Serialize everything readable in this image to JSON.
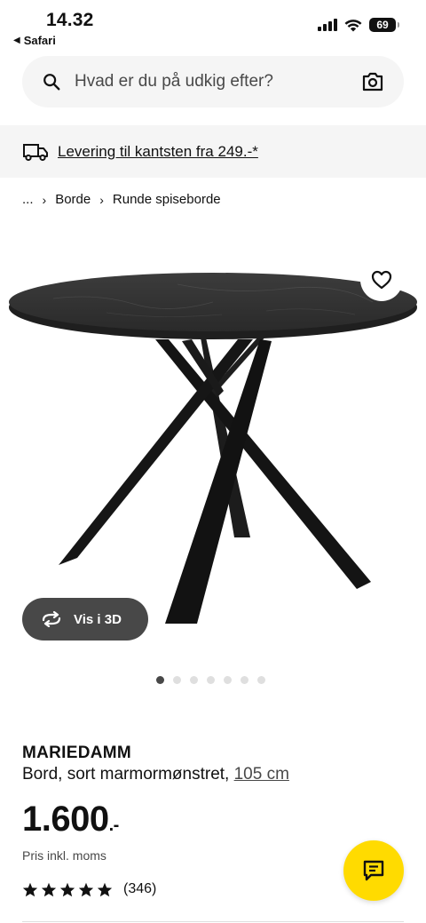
{
  "status_bar": {
    "time": "14.32",
    "back_app": "Safari",
    "battery": "69"
  },
  "search": {
    "placeholder": "Hvad er du på udkig efter?"
  },
  "delivery": {
    "text": "Levering til kantsten fra 249.-*"
  },
  "breadcrumb": {
    "items": [
      "...",
      "Borde",
      "Runde spiseborde"
    ]
  },
  "gallery": {
    "view3d_label": "Vis i 3D",
    "image_count": 7,
    "active_index": 0
  },
  "product": {
    "name": "MARIEDAMM",
    "description": "Bord, sort marmormønstret, ",
    "size": "105 cm",
    "price": "1.600",
    "price_suffix": ".-",
    "price_note": "Pris inkl. moms",
    "rating_stars": 5,
    "rating_count": "(346)"
  },
  "colors": {
    "accent_yellow": "#ffdb00",
    "dark_grey": "#484848",
    "light_grey": "#f5f5f5"
  }
}
